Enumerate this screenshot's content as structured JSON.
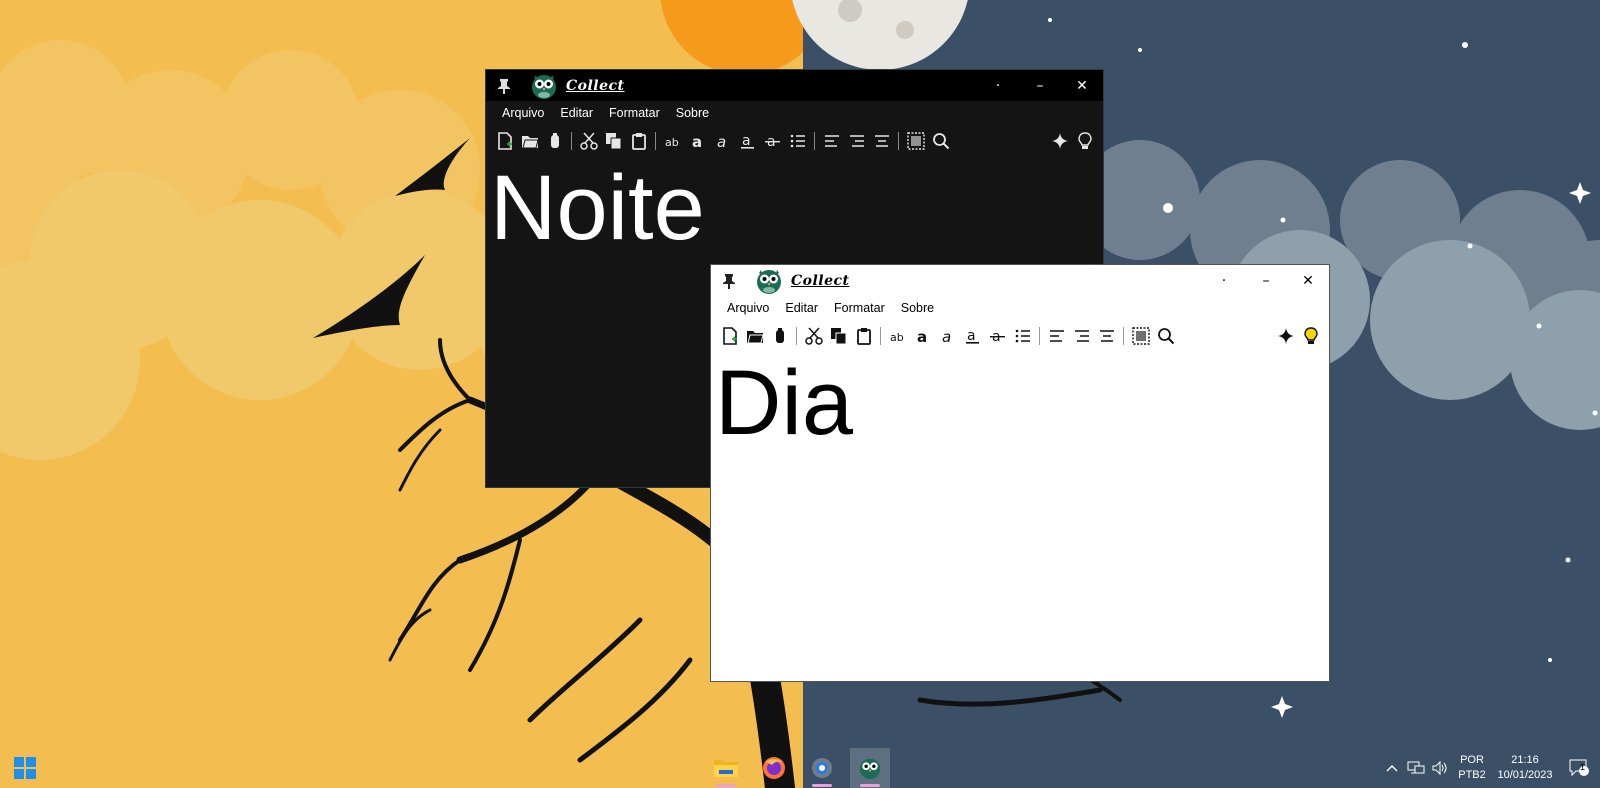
{
  "windows": [
    {
      "id": "dark",
      "title": "Collect",
      "theme": "dark",
      "menu": [
        "Arquivo",
        "Editar",
        "Formatar",
        "Sobre"
      ],
      "content": "Noite",
      "controls": {
        "dot": "·",
        "minimize": "–",
        "close": "✕"
      }
    },
    {
      "id": "light",
      "title": "Collect",
      "theme": "light",
      "menu": [
        "Arquivo",
        "Editar",
        "Formatar",
        "Sobre"
      ],
      "content": "Dia",
      "controls": {
        "dot": "·",
        "minimize": "–",
        "close": "✕"
      }
    }
  ],
  "toolbar_icons": [
    "new-file-icon",
    "open-file-icon",
    "save-icon",
    "cut-icon",
    "copy-icon",
    "paste-icon",
    "font-icon",
    "bold-icon",
    "italic-icon",
    "underline-icon",
    "strikethrough-icon",
    "bullet-list-icon",
    "align-left-icon",
    "align-right-icon",
    "align-center-icon",
    "select-all-icon",
    "search-icon",
    "sparkle-icon",
    "lightbulb-icon"
  ],
  "taskbar": {
    "apps": [
      "file-explorer-icon",
      "firefox-icon",
      "settings-icon",
      "collect-app-icon"
    ],
    "tray": {
      "language_top": "POR",
      "language_bottom": "PTB2",
      "time": "21:16",
      "date": "10/01/2023",
      "notifications": "1"
    }
  },
  "colors": {
    "day_sky": "#f4bd50",
    "night_sky": "#3b5066",
    "dark_window_bg": "#141414",
    "light_window_bg": "#ffffff",
    "bulb_lit": "#f5d400"
  }
}
